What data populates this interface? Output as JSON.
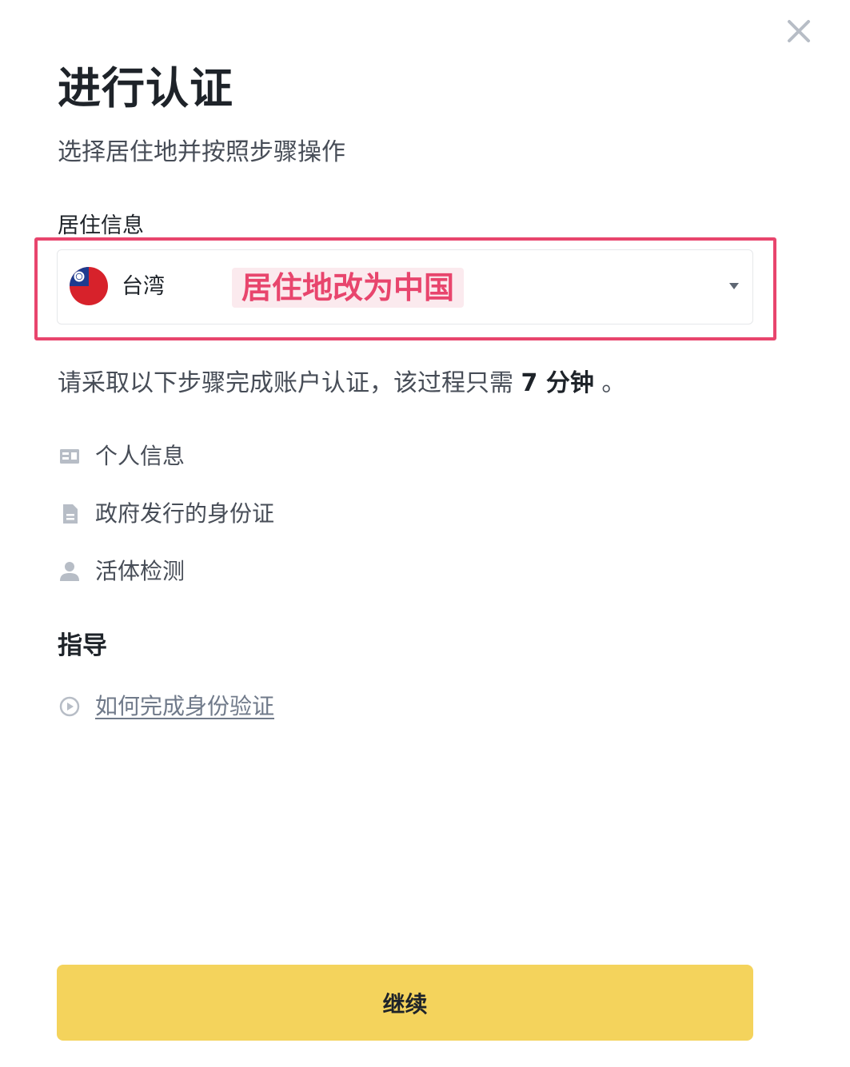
{
  "modal": {
    "title": "进行认证",
    "subtitle": "选择居住地并按照步骤操作",
    "close_icon": "close-icon"
  },
  "residence": {
    "label": "居住信息",
    "selected_country": "台湾",
    "flag_icon": "taiwan-flag-icon",
    "annotation": "居住地改为中国",
    "annotation_color": "#e8456d"
  },
  "info": {
    "prefix": "请采取以下步骤完成账户认证，该过程只需",
    "duration": "7 分钟",
    "suffix": "。"
  },
  "steps": [
    {
      "icon": "id-card-icon",
      "label": "个人信息"
    },
    {
      "icon": "document-icon",
      "label": "政府发行的身份证"
    },
    {
      "icon": "person-icon",
      "label": "活体检测"
    }
  ],
  "guide": {
    "title": "指导",
    "link_label": "如何完成身份验证",
    "link_icon": "play-circle-icon"
  },
  "footer": {
    "continue_label": "继续",
    "button_color": "#f4d35c"
  }
}
